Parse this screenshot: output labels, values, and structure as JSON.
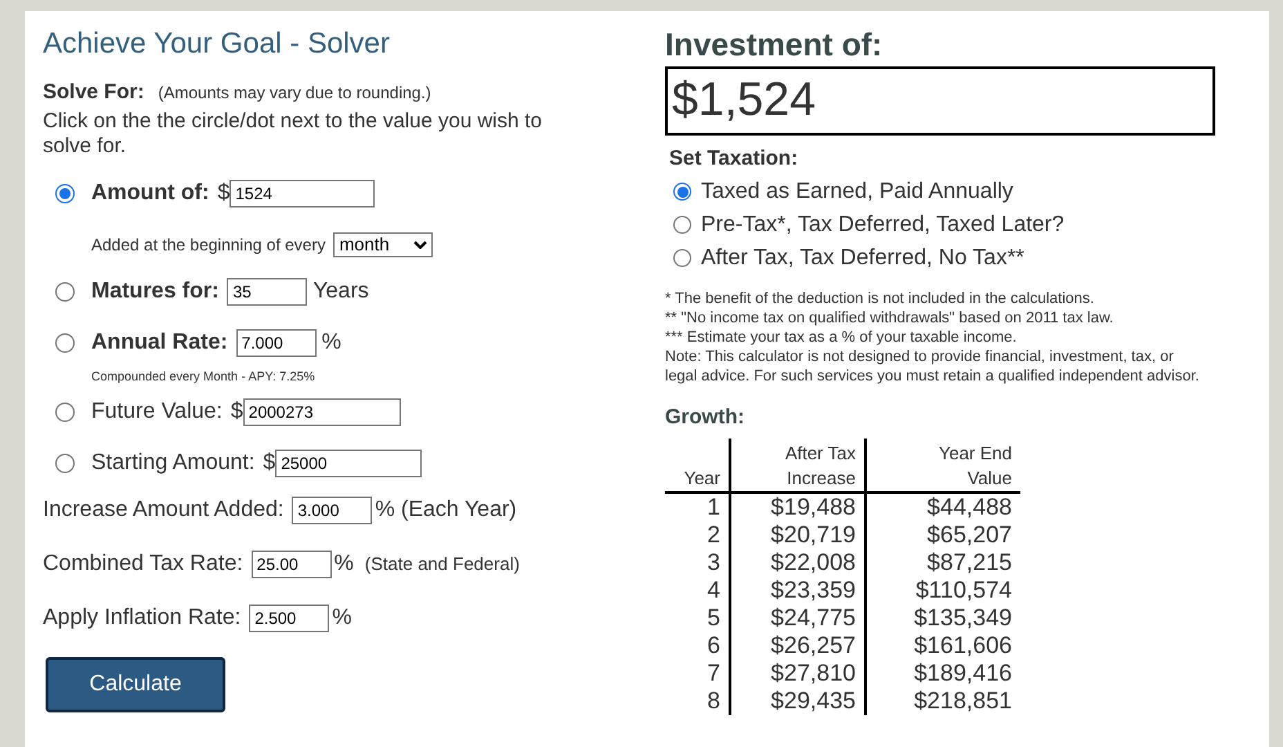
{
  "solver": {
    "title": "Achieve Your Goal - Solver",
    "solve_for_label": "Solve For:",
    "solve_for_note": "(Amounts may vary due to rounding.)",
    "instructions": "Click on the the circle/dot next to the value you wish to solve for.",
    "options": [
      {
        "label": "Amount of:",
        "bold": true,
        "prefix": "$",
        "value": "1524",
        "selected": true,
        "frequency_label": "Added at the beginning of every",
        "frequency": "month"
      },
      {
        "label": "Matures for:",
        "bold": true,
        "value": "35",
        "suffix": "Years",
        "selected": false
      },
      {
        "label": "Annual Rate:",
        "bold": true,
        "value": "7.000",
        "suffix": "%",
        "selected": false,
        "note": "Compounded every Month - APY: 7.25%"
      },
      {
        "label": "Future Value:",
        "bold": false,
        "prefix": "$",
        "value": "2000273",
        "selected": false
      },
      {
        "label": "Starting Amount:",
        "bold": false,
        "prefix": "$",
        "value": "25000",
        "selected": false
      }
    ],
    "fields": [
      {
        "label": "Increase Amount Added:",
        "value": "3.000",
        "suffix": "% (Each Year)"
      },
      {
        "label": "Combined Tax Rate:",
        "value": "25.00",
        "suffix": "%",
        "note": "(State and Federal)"
      },
      {
        "label": "Apply Inflation Rate:",
        "value": "2.500",
        "suffix": "%"
      }
    ],
    "calculate_button": "Calculate"
  },
  "result": {
    "heading": "Investment of:",
    "amount": "$1,524",
    "taxation_heading": "Set Taxation:",
    "taxation_options": [
      {
        "label": "Taxed as Earned, Paid Annually",
        "selected": true
      },
      {
        "label": "Pre-Tax*, Tax Deferred, Taxed Later?",
        "selected": false
      },
      {
        "label": "After Tax, Tax Deferred, No Tax**",
        "selected": false
      }
    ],
    "footnotes": [
      "* The benefit of the deduction is not included in the calculations.",
      "** \"No income tax on qualified withdrawals\" based on 2011 tax law.",
      "*** Estimate your tax as a % of your taxable income.",
      "Note: This calculator is not designed to provide financial, investment, tax, or legal advice. For such services you must retain a qualified independent advisor."
    ],
    "growth_heading": "Growth:",
    "table": {
      "columns": [
        "Year",
        "After Tax Increase",
        "Year End Value"
      ],
      "rows": [
        [
          "1",
          "$19,488",
          "$44,488"
        ],
        [
          "2",
          "$20,719",
          "$65,207"
        ],
        [
          "3",
          "$22,008",
          "$87,215"
        ],
        [
          "4",
          "$23,359",
          "$110,574"
        ],
        [
          "5",
          "$24,775",
          "$135,349"
        ],
        [
          "6",
          "$26,257",
          "$161,606"
        ],
        [
          "7",
          "$27,810",
          "$189,416"
        ],
        [
          "8",
          "$29,435",
          "$218,851"
        ]
      ]
    }
  }
}
